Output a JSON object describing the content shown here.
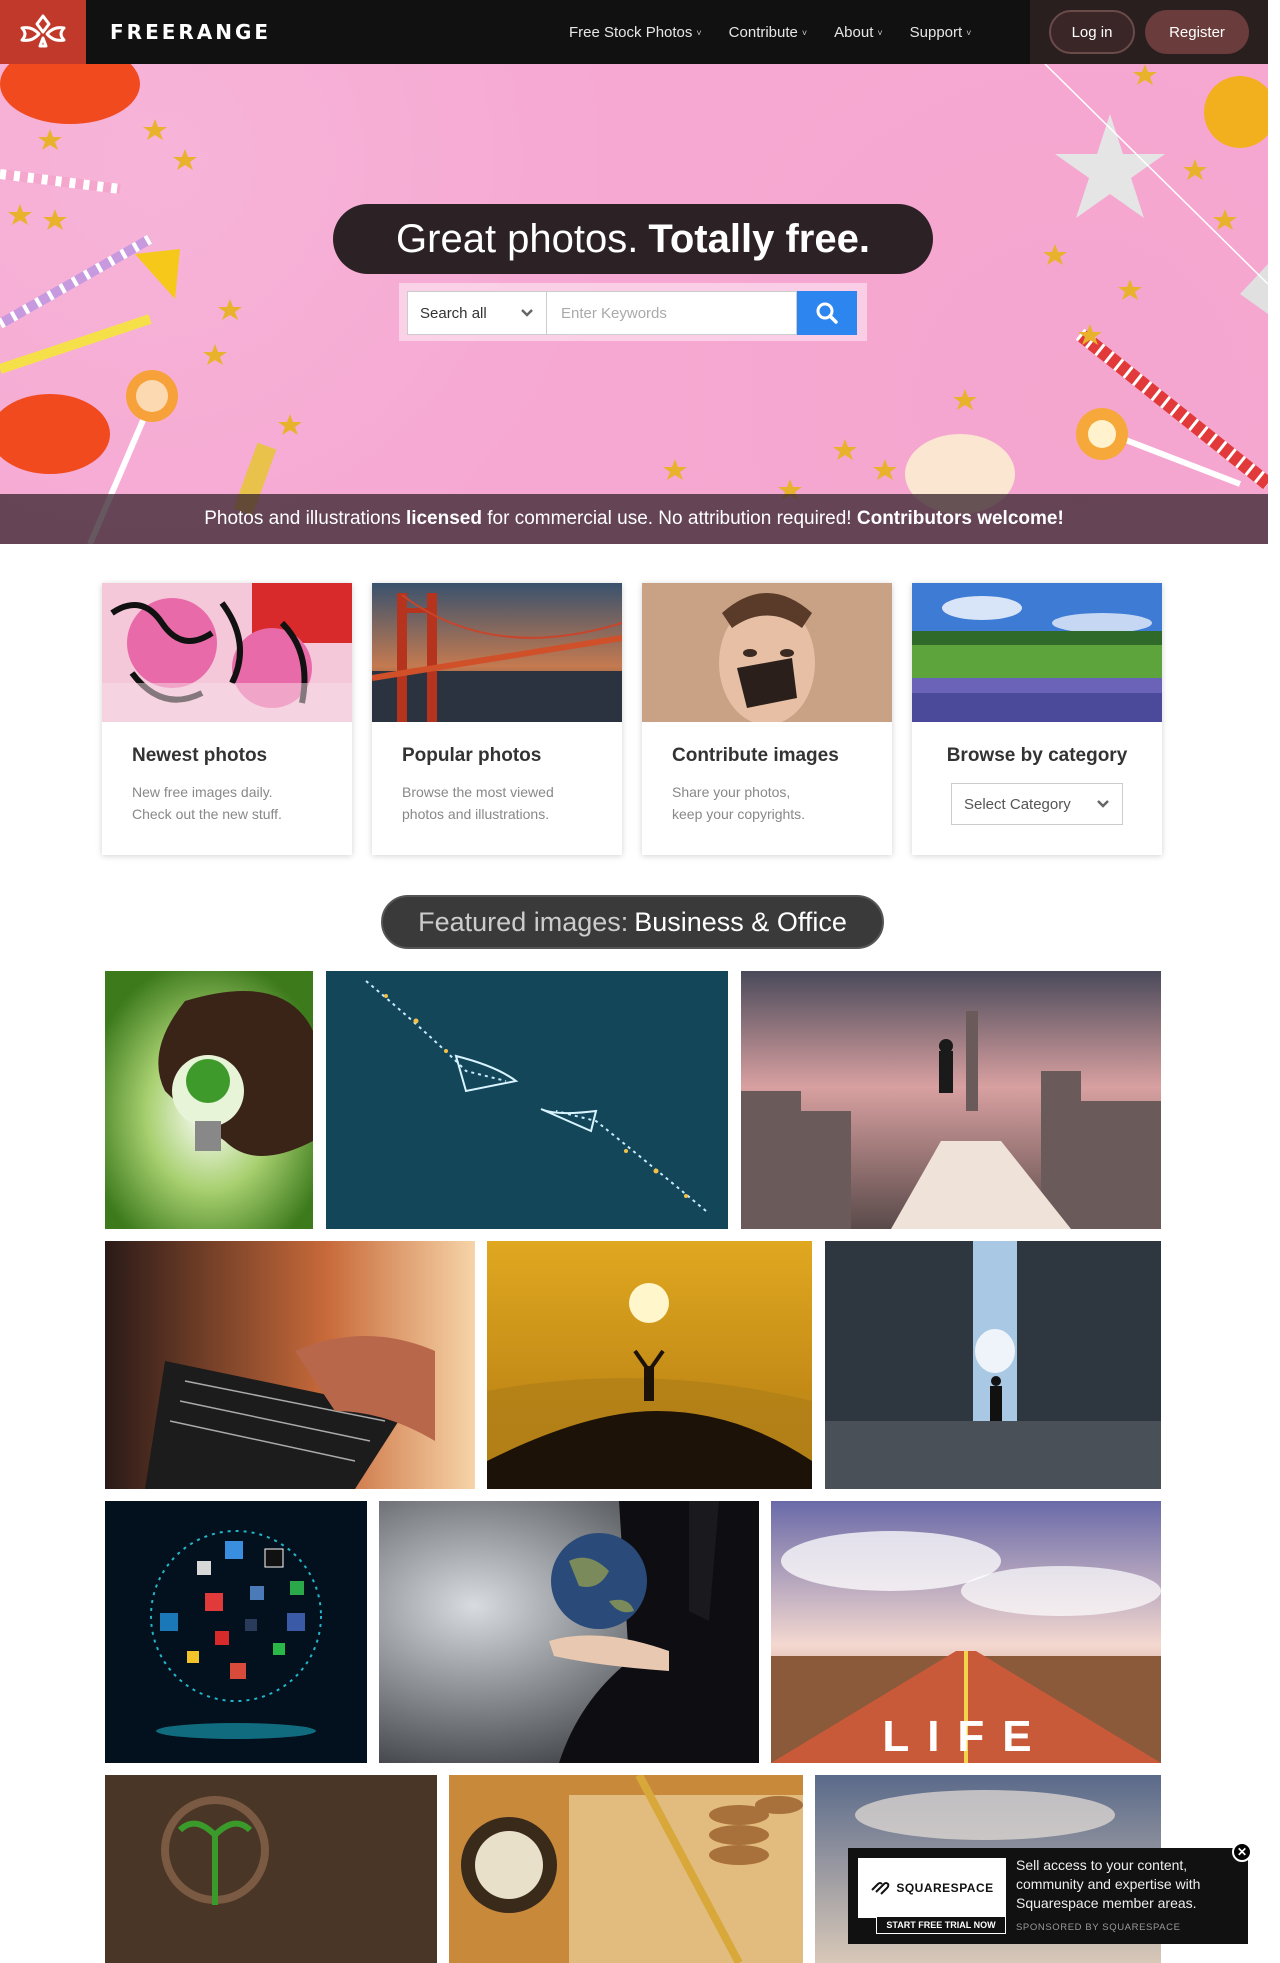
{
  "brand": {
    "name": "FREERANGE",
    "logo_icon": "freerange-logo-icon",
    "accent": "#c0392b"
  },
  "nav": {
    "items": [
      {
        "label": "Free Stock Photos"
      },
      {
        "label": "Contribute"
      },
      {
        "label": "About"
      },
      {
        "label": "Support"
      }
    ],
    "login_label": "Log in",
    "register_label": "Register"
  },
  "hero": {
    "title_light": "Great photos.",
    "title_bold": "Totally free.",
    "search_scope": "Search all",
    "search_placeholder": "Enter Keywords",
    "search_icon": "search-icon",
    "search_button_color": "#2d86f0",
    "bar_part1": "Photos and illustrations",
    "bar_bold1": "licensed",
    "bar_part2": "for commercial use. No attribution required!",
    "bar_bold2": "Contributors welcome!"
  },
  "cards": [
    {
      "title": "Newest photos",
      "desc": "New free images daily.\nCheck out the new stuff."
    },
    {
      "title": "Popular photos",
      "desc": "Browse the most viewed\nphotos and illustrations."
    },
    {
      "title": "Contribute images",
      "desc": "Share your photos,\nkeep your copyrights."
    },
    {
      "title": "Browse by category",
      "select_label": "Select Category"
    }
  ],
  "featured": {
    "prefix": "Featured images:",
    "category": "Business & Office"
  },
  "ad": {
    "logo_text": "SQUARESPACE",
    "cta": "START FREE TRIAL NOW",
    "text": "Sell access to your content, community and expertise with Squarespace member areas.",
    "sponsor": "SPONSORED BY SQUARESPACE",
    "close": "✕"
  }
}
